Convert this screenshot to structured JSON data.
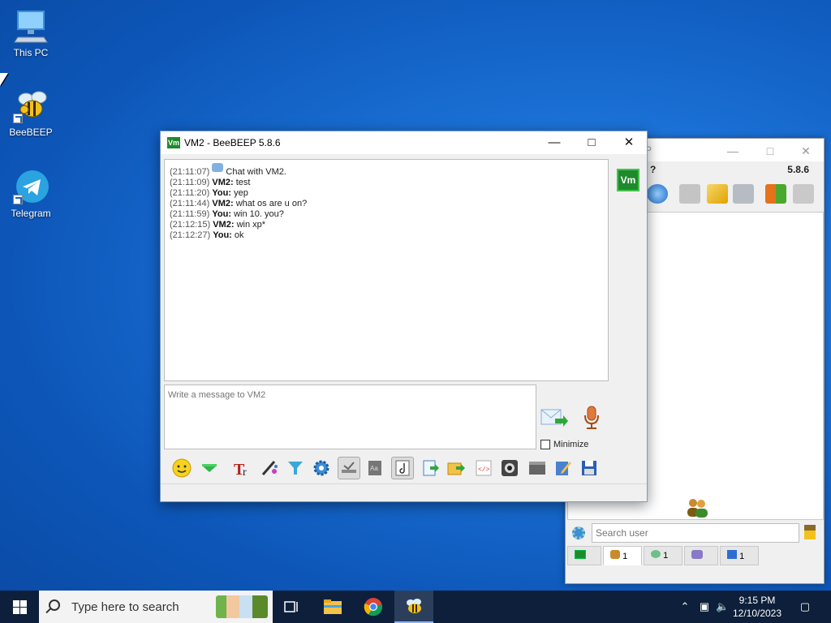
{
  "desktop": {
    "icons": [
      {
        "label": "This PC"
      },
      {
        "label": "BeeBEEP"
      },
      {
        "label": "Telegram"
      }
    ]
  },
  "main_window": {
    "title_partial": "P",
    "menu_partial": "?",
    "version": "5.8.6",
    "search_placeholder": "Search user",
    "tabs": [
      {
        "count": ""
      },
      {
        "count": "1"
      },
      {
        "count": "1"
      },
      {
        "count": ""
      },
      {
        "count": "1"
      }
    ]
  },
  "chat_window": {
    "title": "VM2 - BeeBEEP 5.8.6",
    "app_icon_text": "Vm",
    "badge_text": "Vm",
    "messages": [
      {
        "time": "(21:11:07)",
        "sender": "",
        "text": "Chat with VM2."
      },
      {
        "time": "(21:11:09)",
        "sender": "VM2:",
        "text": "test"
      },
      {
        "time": "(21:11:20)",
        "sender": "You:",
        "text": "yep"
      },
      {
        "time": "(21:11:44)",
        "sender": "VM2:",
        "text": "what os are u on?"
      },
      {
        "time": "(21:11:59)",
        "sender": "You:",
        "text": "win 10. you?"
      },
      {
        "time": "(21:12:15)",
        "sender": "VM2:",
        "text": "win xp*"
      },
      {
        "time": "(21:12:27)",
        "sender": "You:",
        "text": "ok"
      }
    ],
    "compose_placeholder": "Write a message to VM2",
    "minimize_label": "Minimize",
    "minimize_checked": false
  },
  "taskbar": {
    "search_placeholder": "Type here to search",
    "time": "9:15 PM",
    "date": "12/10/2023"
  },
  "colors": {
    "accent_green": "#1e8a2c",
    "desktop_blue": "#1a6fd4",
    "taskbar": "#0d1f3a"
  }
}
